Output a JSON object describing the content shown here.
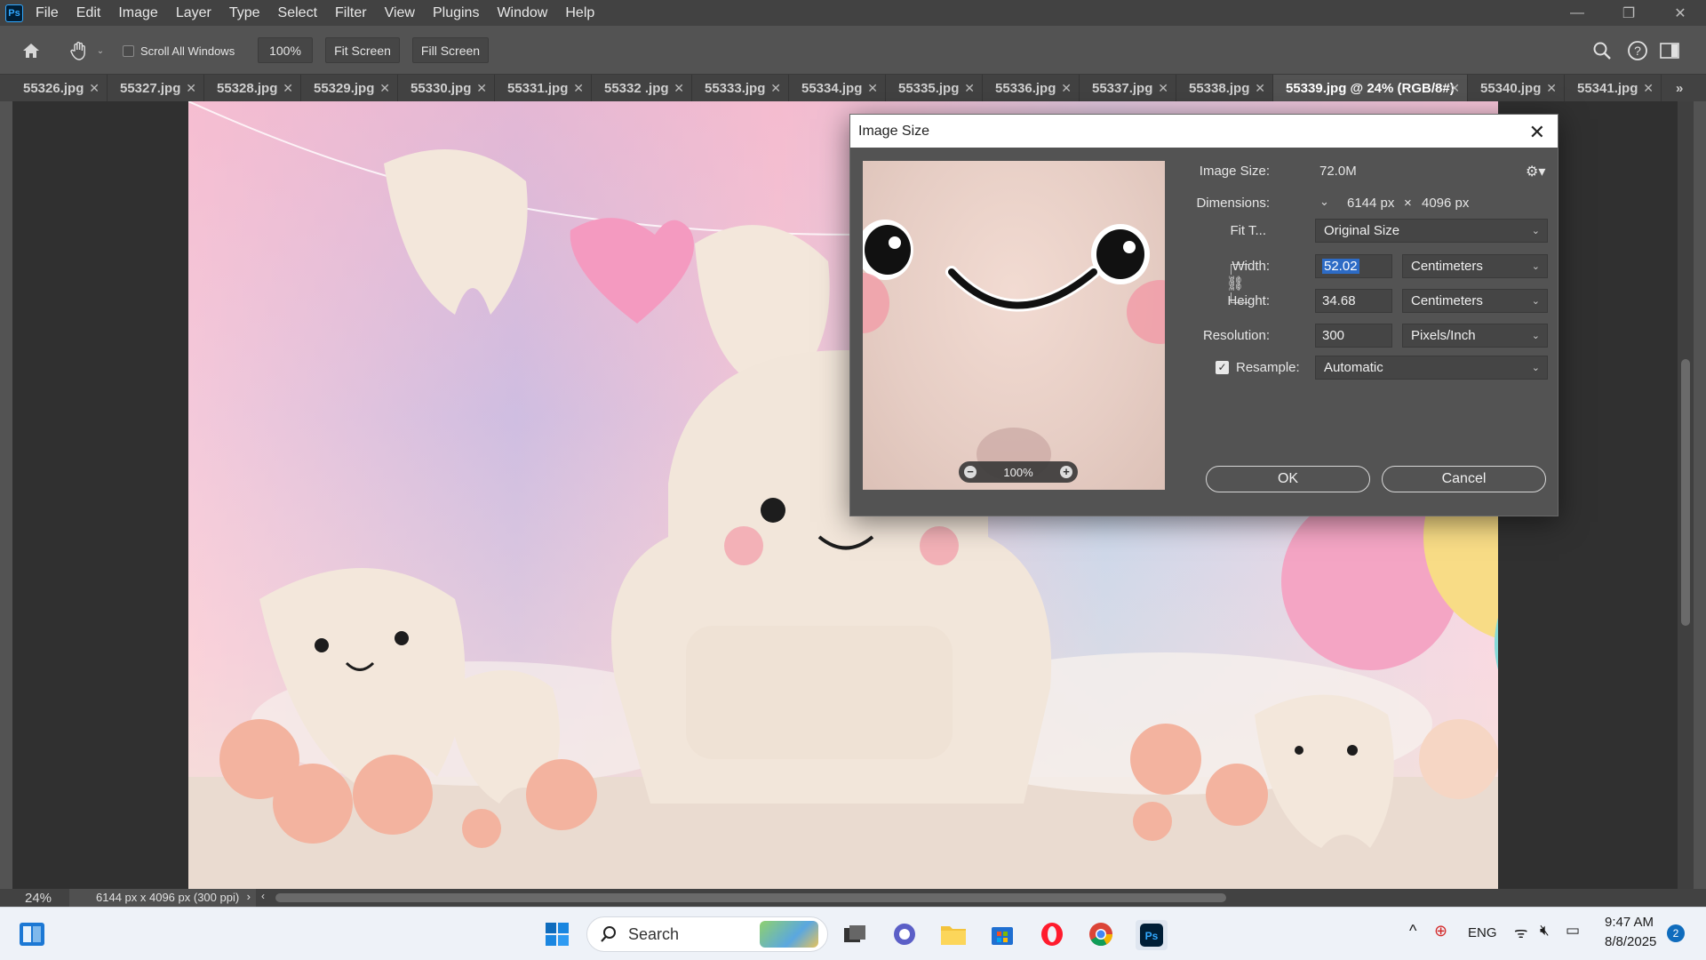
{
  "app": {
    "logo": "Ps"
  },
  "menu": [
    "File",
    "Edit",
    "Image",
    "Layer",
    "Type",
    "Select",
    "Filter",
    "View",
    "Plugins",
    "Window",
    "Help"
  ],
  "options": {
    "scroll_all_windows": "Scroll All Windows",
    "zoom_value": "100%",
    "fit_screen": "Fit Screen",
    "fill_screen": "Fill Screen"
  },
  "tabs": [
    {
      "label": "55326.jpg"
    },
    {
      "label": "55327.jpg"
    },
    {
      "label": "55328.jpg"
    },
    {
      "label": "55329.jpg"
    },
    {
      "label": "55330.jpg"
    },
    {
      "label": "55331.jpg"
    },
    {
      "label": "55332 .jpg"
    },
    {
      "label": "55333.jpg"
    },
    {
      "label": "55334.jpg"
    },
    {
      "label": "55335.jpg"
    },
    {
      "label": "55336.jpg"
    },
    {
      "label": "55337.jpg"
    },
    {
      "label": "55338.jpg"
    },
    {
      "label": "55339.jpg @ 24% (RGB/8#)",
      "active": true
    },
    {
      "label": "55340.jpg"
    },
    {
      "label": "55341.jpg"
    }
  ],
  "status": {
    "zoom": "24%",
    "doc_info": "6144 px x 4096 px (300 ppi)"
  },
  "dialog": {
    "title": "Image Size",
    "image_size_label": "Image Size:",
    "image_size_value": "72.0M",
    "dimensions_label": "Dimensions:",
    "dim_width": "6144 px",
    "dim_x": "×",
    "dim_height": "4096 px",
    "fit_label": "Fit T...",
    "fit_value": "Original Size",
    "width_label": "Width:",
    "width_value": "52.02",
    "width_unit": "Centimeters",
    "height_label": "Height:",
    "height_value": "34.68",
    "height_unit": "Centimeters",
    "resolution_label": "Resolution:",
    "resolution_value": "300",
    "resolution_unit": "Pixels/Inch",
    "resample_label": "Resample:",
    "resample_value": "Automatic",
    "preview_zoom": "100%",
    "ok": "OK",
    "cancel": "Cancel"
  },
  "taskbar": {
    "search": "Search",
    "lang": "ENG",
    "time": "9:47 AM",
    "date": "8/8/2025",
    "notifications": "2"
  }
}
